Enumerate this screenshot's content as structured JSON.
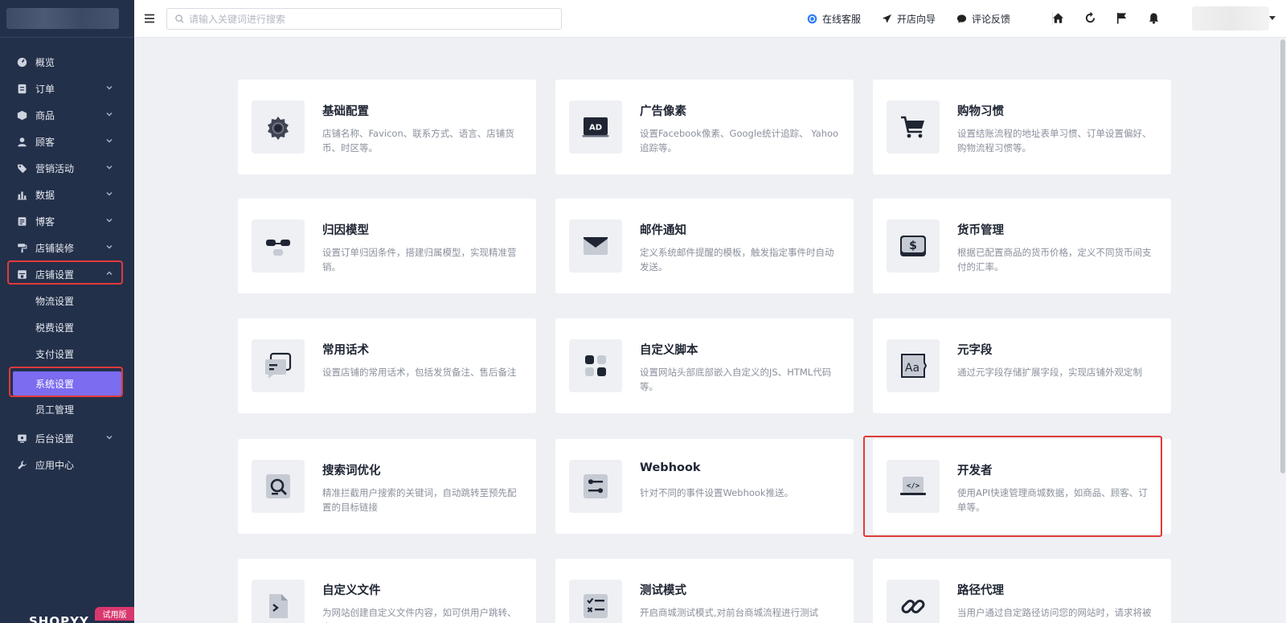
{
  "sidebar": {
    "items": [
      {
        "label": "概览",
        "icon": "dashboard-icon",
        "has_children": false
      },
      {
        "label": "订单",
        "icon": "order-icon",
        "has_children": true
      },
      {
        "label": "商品",
        "icon": "product-icon",
        "has_children": true
      },
      {
        "label": "顾客",
        "icon": "customer-icon",
        "has_children": true
      },
      {
        "label": "营销活动",
        "icon": "tag-icon",
        "has_children": true
      },
      {
        "label": "数据",
        "icon": "chart-icon",
        "has_children": true
      },
      {
        "label": "博客",
        "icon": "blog-icon",
        "has_children": true
      },
      {
        "label": "店铺装修",
        "icon": "paint-roller-icon",
        "has_children": true
      },
      {
        "label": "店铺设置",
        "icon": "store-settings-icon",
        "has_children": true,
        "expanded": true
      }
    ],
    "subitems": [
      {
        "label": "物流设置"
      },
      {
        "label": "税费设置"
      },
      {
        "label": "支付设置"
      },
      {
        "label": "系统设置",
        "active": true
      },
      {
        "label": "员工管理"
      }
    ],
    "bottom_items": [
      {
        "label": "后台设置",
        "icon": "monitor-icon",
        "has_children": true
      },
      {
        "label": "应用中心",
        "icon": "wrench-icon",
        "has_children": false
      }
    ],
    "trial_badge": "试用版",
    "logo_text": "SHOPYY"
  },
  "topbar": {
    "search_placeholder": "请输入关键词进行搜索",
    "links": {
      "support": "在线客服",
      "guide": "开店向导",
      "feedback": "评论反馈"
    }
  },
  "cards": [
    {
      "title": "基础配置",
      "desc": "店铺名称、Favicon、联系方式、语言、店铺货币、时区等。",
      "icon": "gear-icon"
    },
    {
      "title": "广告像素",
      "desc": "设置Facebook像素、Google统计追踪、 Yahoo追踪等。",
      "icon": "ad-icon"
    },
    {
      "title": "购物习惯",
      "desc": "设置结账流程的地址表单习惯、订单设置偏好、购物流程习惯等。",
      "icon": "cart-icon"
    },
    {
      "title": "归因模型",
      "desc": "设置订单归因条件，搭建归属模型，实现精准营销。",
      "icon": "attribution-icon"
    },
    {
      "title": "邮件通知",
      "desc": "定义系统邮件提醒的模板，触发指定事件时自动发送。",
      "icon": "mail-icon"
    },
    {
      "title": "货币管理",
      "desc": "根据已配置商品的货币价格，定义不同货币间支付的汇率。",
      "icon": "currency-icon"
    },
    {
      "title": "常用话术",
      "desc": "设置店铺的常用话术，包括发货备注、售后备注",
      "icon": "chat-icon"
    },
    {
      "title": "自定义脚本",
      "desc": "设置网站头部底部嵌入自定义的JS、HTML代码等。",
      "icon": "script-icon"
    },
    {
      "title": "元字段",
      "desc": "通过元字段存储扩展字段，实现店铺外观定制",
      "icon": "metafield-icon"
    },
    {
      "title": "搜索词优化",
      "desc": "精准拦截用户搜索的关键词，自动跳转至预先配置的目标链接",
      "icon": "search-optimize-icon"
    },
    {
      "title": "Webhook",
      "desc": "针对不同的事件设置Webhook推送。",
      "icon": "webhook-icon"
    },
    {
      "title": "开发者",
      "desc": "使用API快速管理商城数据，如商品、顾客、订单等。",
      "icon": "developer-icon",
      "highlighted": true
    },
    {
      "title": "自定义文件",
      "desc": "为网站创建自定义文件内容，如可供用户跳转、上",
      "icon": "file-icon"
    },
    {
      "title": "测试模式",
      "desc": "开启商城测试模式,对前台商城流程进行测试",
      "icon": "test-icon"
    },
    {
      "title": "路径代理",
      "desc": "当用户通过自定路径访问您的网站时，请求将被",
      "icon": "link-icon"
    }
  ],
  "colors": {
    "sidebar_bg": "#23304a",
    "accent": "#7b6cf0",
    "highlight": "#e23a3a",
    "trial": "#d9386f"
  }
}
